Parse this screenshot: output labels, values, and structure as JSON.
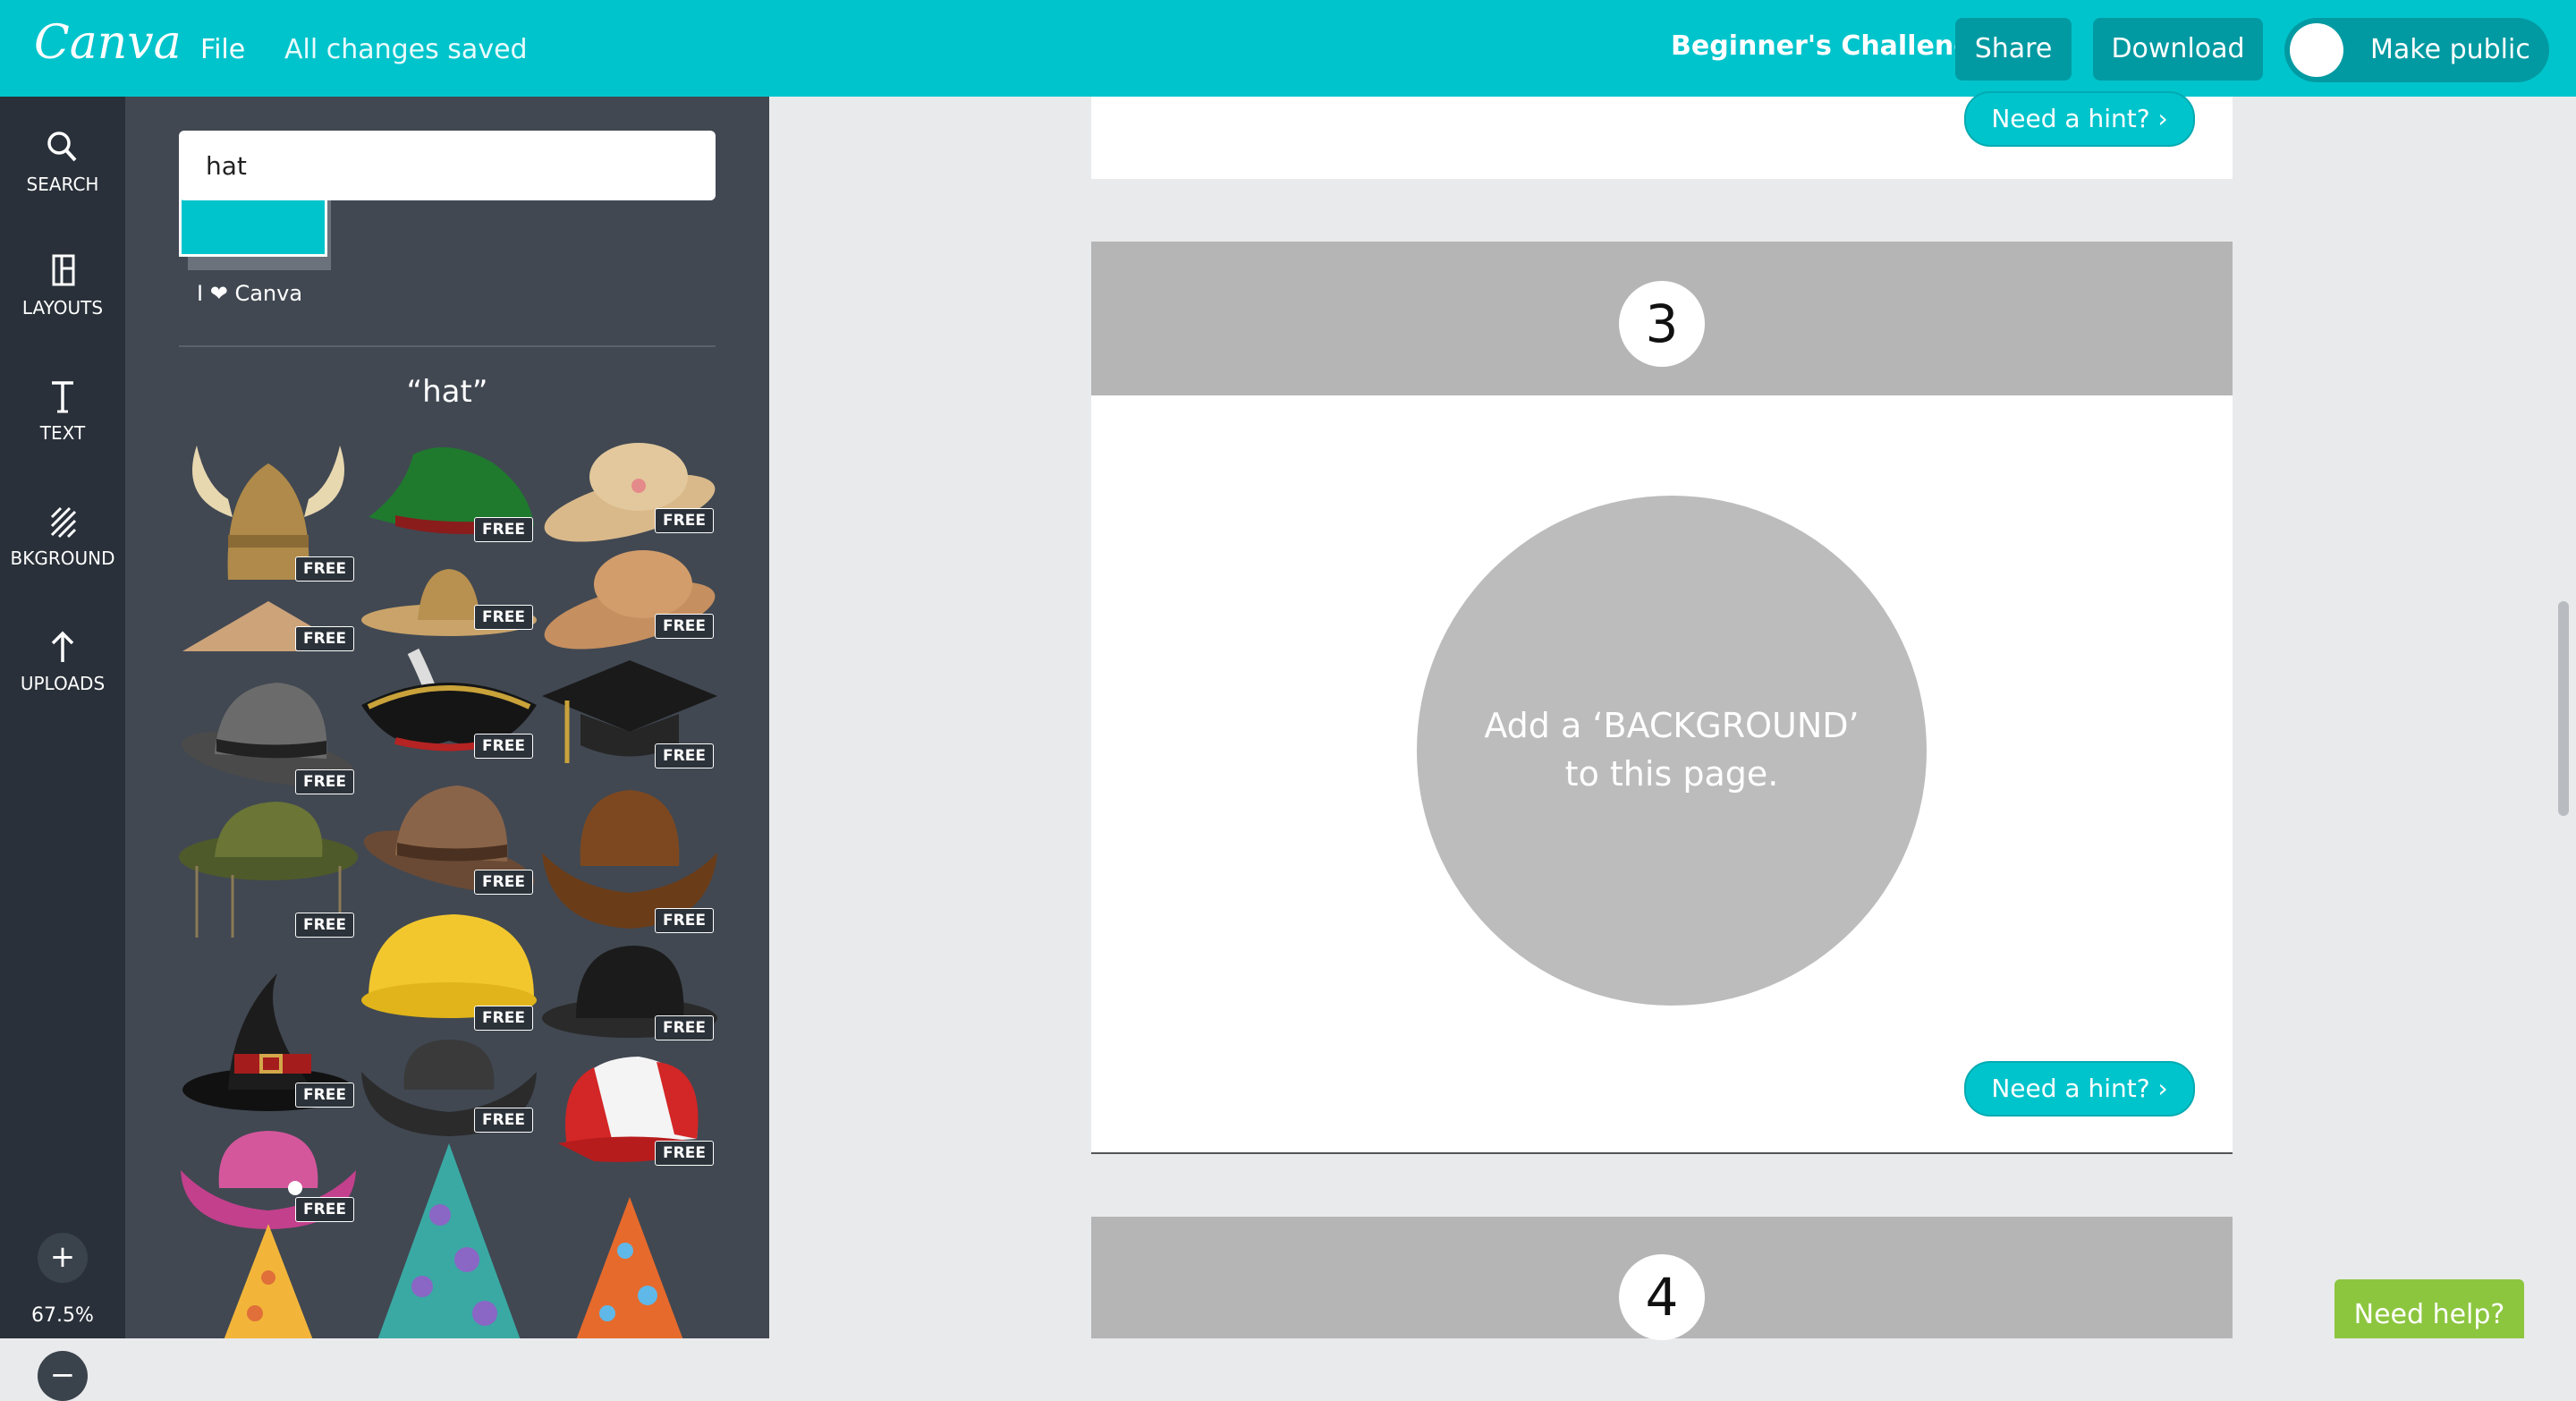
{
  "topbar": {
    "logo": "Canva",
    "file_label": "File",
    "saved_status": "All changes saved",
    "project_title": "Beginner's Challenge",
    "share_label": "Share",
    "download_label": "Download",
    "make_public_label": "Make public"
  },
  "rail": {
    "items": [
      {
        "label": "SEARCH",
        "icon": "search-icon"
      },
      {
        "label": "LAYOUTS",
        "icon": "layouts-icon"
      },
      {
        "label": "TEXT",
        "icon": "text-icon"
      },
      {
        "label": "BKGROUND",
        "icon": "background-icon"
      },
      {
        "label": "UPLOADS",
        "icon": "upload-icon"
      }
    ],
    "zoom": "67.5%",
    "zoom_in": "+",
    "zoom_out": "−"
  },
  "panel": {
    "search_value": "hat",
    "canva_caption_prefix": "I",
    "canva_caption_suffix": "Canva",
    "results_title": "“hat”",
    "free_badge": "FREE"
  },
  "canvas": {
    "hint_label": "Need a hint?",
    "page3_number": "3",
    "page3_circle_text_line1": "Add a ‘BACKGROUND’",
    "page3_circle_text_line2": "to this page.",
    "page4_number": "4"
  },
  "help": {
    "label": "Need help?"
  },
  "colors": {
    "brand_teal": "#00c4cc",
    "rail_bg": "#293039",
    "panel_bg": "#414852",
    "help_green": "#8cc63f"
  }
}
